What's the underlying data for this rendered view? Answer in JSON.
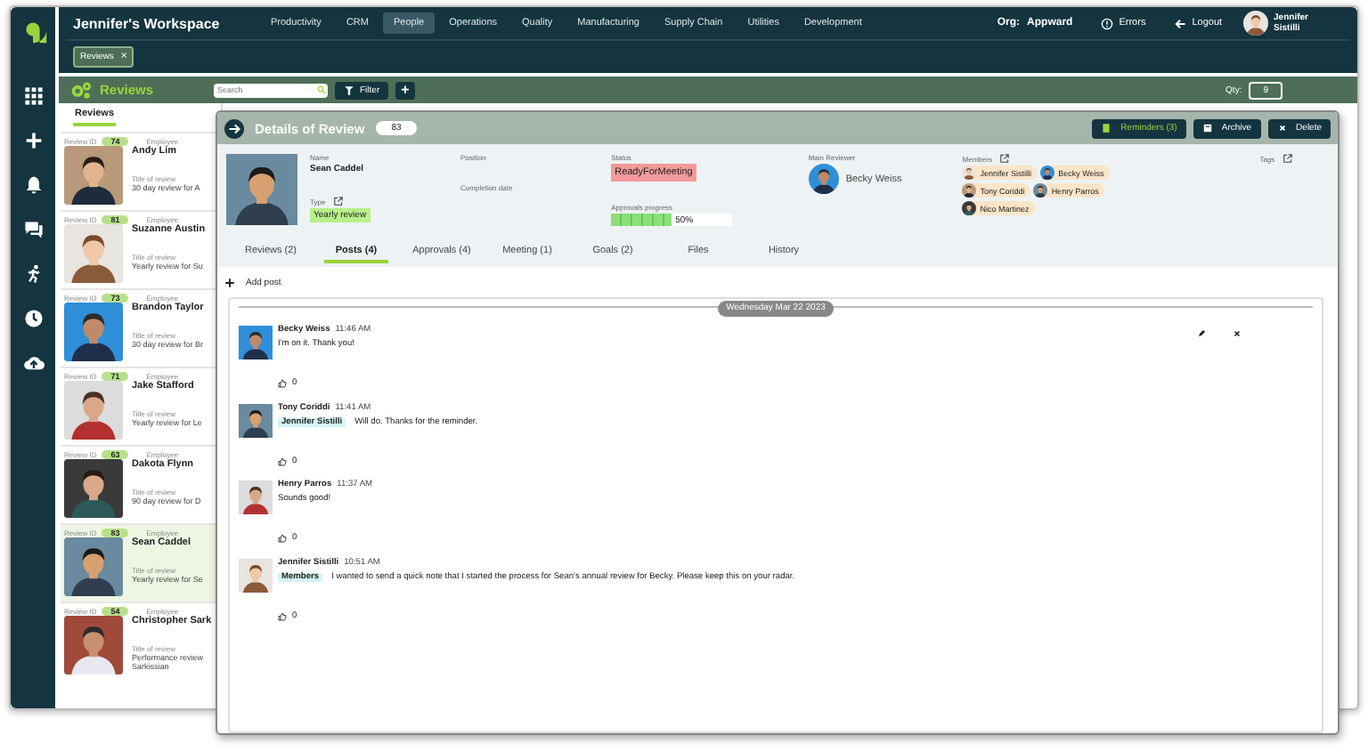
{
  "app_bar": {
    "workspace": "Jennifer's Workspace",
    "nav": [
      {
        "label": "Productivity",
        "selected": false
      },
      {
        "label": "CRM",
        "selected": false
      },
      {
        "label": "People",
        "selected": true
      },
      {
        "label": "Operations",
        "selected": false
      },
      {
        "label": "Quality",
        "selected": false
      },
      {
        "label": "Manufacturing",
        "selected": false
      },
      {
        "label": "Supply Chain",
        "selected": false
      },
      {
        "label": "Utilities",
        "selected": false
      },
      {
        "label": "Development",
        "selected": false
      }
    ],
    "org_label": "Org:",
    "org": "Appward",
    "errors": "Errors",
    "logout": "Logout",
    "user": "Jennifer Sistilli"
  },
  "open_tabs": [
    {
      "label": "Reviews",
      "close": "×"
    }
  ],
  "toolbar": {
    "title": "Reviews",
    "search_placeholder": "Search",
    "filter": "Filter",
    "add": "+",
    "qty_label": "Qty:",
    "qty": "9"
  },
  "list": {
    "tab": "Reviews",
    "cards": [
      {
        "id_label": "Review ID",
        "id": "74",
        "employee_label": "Employee",
        "name": "Andy Lim",
        "title_label": "Title of review",
        "title_lines": [
          "30 day review for A"
        ],
        "selected": false
      },
      {
        "id_label": "Review ID",
        "id": "81",
        "employee_label": "Employee",
        "name": "Suzanne Austin",
        "title_label": "Title of review",
        "title_lines": [
          "Yearly review for Su"
        ],
        "selected": false
      },
      {
        "id_label": "Review ID",
        "id": "73",
        "employee_label": "Employee",
        "name": "Brandon Taylor",
        "title_label": "Title of review",
        "title_lines": [
          "30 day review for Br"
        ],
        "selected": false
      },
      {
        "id_label": "Review ID",
        "id": "71",
        "employee_label": "Employee",
        "name": "Jake Stafford",
        "title_label": "Title of review",
        "title_lines": [
          "Yearly review for Le"
        ],
        "selected": false
      },
      {
        "id_label": "Review ID",
        "id": "63",
        "employee_label": "Employee",
        "name": "Dakota Flynn",
        "title_label": "Title of review",
        "title_lines": [
          "90 day review for D"
        ],
        "selected": false
      },
      {
        "id_label": "Review ID",
        "id": "83",
        "employee_label": "Employee",
        "name": "Sean Caddel",
        "title_label": "Title of review",
        "title_lines": [
          "Yearly review for Se"
        ],
        "selected": true
      },
      {
        "id_label": "Review ID",
        "id": "54",
        "employee_label": "Employee",
        "name": "Christopher Sark",
        "title_label": "Title of review",
        "title_lines": [
          "Performance review",
          "Sarkissian"
        ],
        "selected": false
      }
    ]
  },
  "details": {
    "title": "Details of Review",
    "id": "83",
    "reminders": "Reminders (3)",
    "archive": "Archive",
    "delete": "Delete",
    "name_label": "Name",
    "name": "Sean Caddel",
    "position_label": "Position",
    "status_label": "Status",
    "status": "ReadyForMeeting",
    "type_label": "Type",
    "type": "Yearly review",
    "completion_label": "Completion date",
    "progress_label": "Approvals progress",
    "progress": {
      "level": 0.5,
      "reading": "50%"
    },
    "reviewer_label": "Main Reviewer",
    "reviewer": "Becky Weiss",
    "members_label": "Members",
    "members": [
      "Jennifer Sistilli",
      "Becky Weiss",
      "Tony Coriddi",
      "Henry Parros",
      "Nico Martinez"
    ],
    "tags_label": "Tags",
    "tabs": [
      {
        "label": "Reviews (2)",
        "selected": false
      },
      {
        "label": "Posts (4)",
        "selected": true
      },
      {
        "label": "Approvals (4)",
        "selected": false
      },
      {
        "label": "Meeting (1)",
        "selected": false
      },
      {
        "label": "Goals (2)",
        "selected": false
      },
      {
        "label": "Files",
        "selected": false
      },
      {
        "label": "History",
        "selected": false
      }
    ],
    "add_post": "Add post",
    "date": "Wednesday Mar 22 2023",
    "posts": [
      {
        "author": "Becky Weiss",
        "time": "11:46 AM",
        "text": "I'm on it. Thank you!",
        "likes": "0",
        "show_actions": true
      },
      {
        "author": "Tony Coriddi",
        "time": "11:41 AM",
        "mention": "Jennifer Sistilli",
        "text": "Will do. Thanks for the reminder.",
        "likes": "0",
        "show_actions": false
      },
      {
        "author": "Henry Parros",
        "time": "11:37 AM",
        "text": "Sounds good!",
        "likes": "0",
        "show_actions": false
      },
      {
        "author": "Jennifer Sistilli",
        "time": "10:51 AM",
        "mention": "Members",
        "text": "I wanted to send a quick note that I started the process for Sean's annual review for Becky. Please keep this on your radar.",
        "likes": "0",
        "show_actions": false
      }
    ]
  }
}
